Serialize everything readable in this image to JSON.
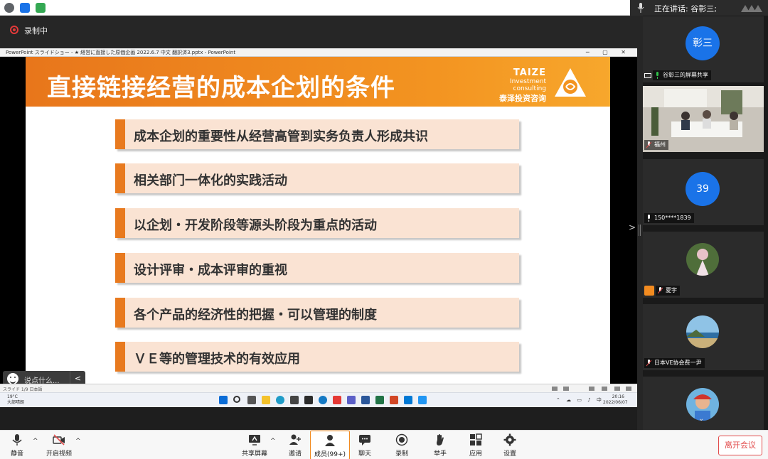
{
  "top": {
    "speaker_label": "正在讲话: 谷彰三;"
  },
  "recording": {
    "label": "录制中"
  },
  "ppt": {
    "window_title": "PowerPoint スライドショー - ★ 経営に直接した原価企画 2022.6.7 中文 翻訳済3.pptx - PowerPoint",
    "status_left": "スライド 1/9 日本語"
  },
  "slide": {
    "title": "直接链接经营的成本企划的条件",
    "brand_en": "TAIZE",
    "brand_sub": "Investment consulting",
    "brand_cn": "泰泽投资咨询",
    "bullets": [
      "成本企划的重要性从经营高管到实务负责人形成共识",
      "相关部门一体化的实践活动",
      "以企划・开发阶段等源头阶段为重点的活动",
      "设计评审・成本评审的重视",
      "各个产品的经济性的把握・可以管理的制度",
      "ＶＥ等的管理技术的有效应用"
    ],
    "accent": "#e87a1f",
    "bullet_bg": "#fae3d3"
  },
  "chat": {
    "placeholder": "说点什么..."
  },
  "taskbar": {
    "temp": "19°C",
    "weather": "大部晴朗",
    "time": "20:16",
    "date": "2022/06/07",
    "ime": "中"
  },
  "participants": [
    {
      "kind": "avatar",
      "avatar_text": "彰三",
      "name": "谷彰三的屏幕共享",
      "icon": "screen-share-icon"
    },
    {
      "kind": "video",
      "name": "福州"
    },
    {
      "kind": "avatar",
      "avatar_text": "39",
      "name": "150****1839"
    },
    {
      "kind": "photo",
      "name": "夏宇"
    },
    {
      "kind": "photo",
      "name": "日本VE协会费一尹"
    },
    {
      "kind": "photo",
      "name": ""
    }
  ],
  "toolbar": {
    "mute": "静音",
    "video": "开启视频",
    "share": "共享屏幕",
    "invite": "邀请",
    "members": "成员(99+)",
    "chat": "聊天",
    "record": "录制",
    "raise_hand": "举手",
    "apps": "应用",
    "settings": "设置",
    "leave": "离开会议"
  }
}
